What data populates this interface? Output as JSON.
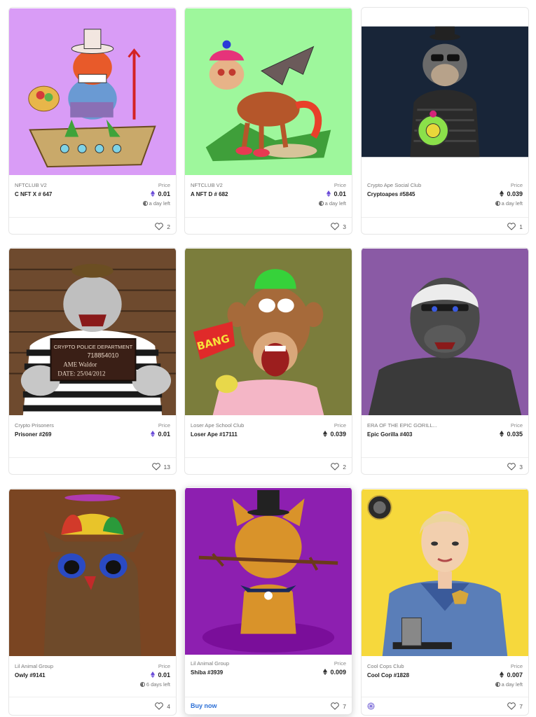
{
  "cards": [
    {
      "collection": "NFTCLUB V2",
      "token": "C NFT X # 647",
      "price_label": "Price",
      "price": "0.01",
      "eth_icon": "ethereum-purple-icon",
      "time_left": "a day left",
      "likes": "2",
      "bg": "#d99cf6"
    },
    {
      "collection": "NFTCLUB V2",
      "token": "A NFT D # 682",
      "price_label": "Price",
      "price": "0.01",
      "eth_icon": "ethereum-purple-icon",
      "time_left": "a day left",
      "likes": "3",
      "bg": "#9ef79c"
    },
    {
      "collection": "Crypto Ape Social Club",
      "token": "Cryptoapes #5845",
      "price_label": "Price",
      "price": "0.039",
      "eth_icon": "ethereum-dark-icon",
      "time_left": "a day left",
      "likes": "1",
      "bg": "#182538"
    },
    {
      "collection": "Crypto Prisoners",
      "token": "Prisoner #269",
      "price_label": "Price",
      "price": "0.01",
      "eth_icon": "ethereum-purple-icon",
      "time_left": "",
      "likes": "13",
      "bg": "#6e4a2e"
    },
    {
      "collection": "Loser Ape School Club",
      "token": "Loser Ape #17111",
      "price_label": "Price",
      "price": "0.039",
      "eth_icon": "ethereum-dark-icon",
      "time_left": "",
      "likes": "2",
      "bg": "#7b7d3c"
    },
    {
      "collection": "ERA OF THE EPIC GORILL...",
      "token": "Epic Gorilla #403",
      "price_label": "Price",
      "price": "0.035",
      "eth_icon": "ethereum-dark-icon",
      "time_left": "",
      "likes": "3",
      "bg": "#8a5aa5"
    },
    {
      "collection": "Lil Animal Group",
      "token": "Owly #9141",
      "price_label": "Price",
      "price": "0.01",
      "eth_icon": "ethereum-purple-icon",
      "time_left": "6 days left",
      "likes": "4",
      "bg": "#7a4522"
    },
    {
      "collection": "Lil Animal Group",
      "token": "Shiba #3939",
      "price_label": "Price",
      "price": "0.009",
      "eth_icon": "ethereum-dark-icon",
      "time_left": "",
      "likes": "7",
      "bg": "#8d1fb0",
      "buy_label": "Buy now"
    },
    {
      "collection": "Cool Cops Club",
      "token": "Cool Cop #1828",
      "price_label": "Price",
      "price": "0.007",
      "eth_icon": "ethereum-dark-icon",
      "time_left": "a day left",
      "likes": "7",
      "bg": "#f6d83c"
    }
  ],
  "images": {
    "prisoner_placard": {
      "line1": "CRYPTO POLICE DEPARTMENT",
      "line2": "718854010",
      "line3": "AME  Waldor",
      "line4": "DATE:  25/04/2012"
    },
    "bang_flag": "BANG"
  },
  "colors": {
    "accent_link": "#2b6fd6",
    "eth_purple": "#6a4bd8"
  }
}
